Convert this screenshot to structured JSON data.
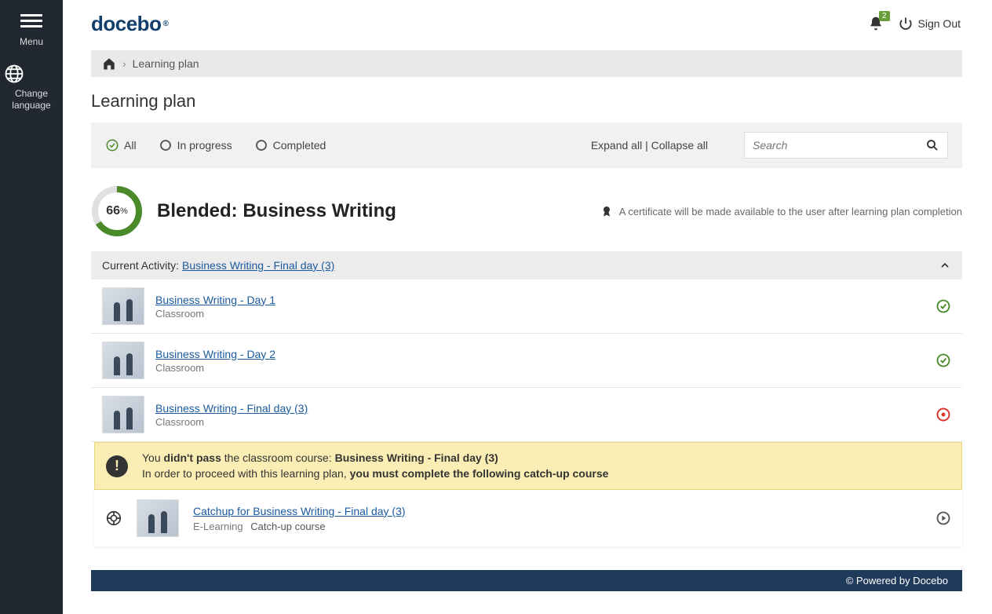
{
  "sidebar": {
    "menu_label": "Menu",
    "change_language_label": "Change\nlanguage"
  },
  "header": {
    "logo_text": "docebo",
    "notification_count": "2",
    "signout_label": "Sign Out"
  },
  "breadcrumb": {
    "sep": "›",
    "current": "Learning plan"
  },
  "page": {
    "title": "Learning plan"
  },
  "filters": {
    "all": "All",
    "in_progress": "In progress",
    "completed": "Completed",
    "expand_all": "Expand all",
    "separator": " | ",
    "collapse_all": "Collapse all",
    "search_placeholder": "Search"
  },
  "plan": {
    "progress_percent": "66",
    "percent_symbol": "%",
    "title": "Blended: Business Writing",
    "certificate_note": "A certificate will be made available to the user after learning plan completion"
  },
  "activity": {
    "label": "Current Activity:",
    "link": "Business Writing - Final day (3)"
  },
  "courses": [
    {
      "title": "Business Writing - Day 1",
      "type": "Classroom",
      "status": "complete"
    },
    {
      "title": "Business Writing - Day 2",
      "type": "Classroom",
      "status": "complete"
    },
    {
      "title": "Business Writing - Final day (3)",
      "type": "Classroom",
      "status": "failed"
    }
  ],
  "warning": {
    "line1_a": "You ",
    "line1_b": "didn't pass",
    "line1_c": " the classroom course: ",
    "line1_d": "Business Writing - Final day (3)",
    "line2_a": "In order to proceed with this learning plan, ",
    "line2_b": "you must complete the following catch-up course"
  },
  "catchup": {
    "title": "Catchup for Business Writing - Final day (3)",
    "type": "E-Learning",
    "tag": "Catch-up course"
  },
  "footer": {
    "text": "© Powered by Docebo"
  },
  "colors": {
    "accent_green": "#4a8a2a",
    "link_blue": "#1a5a9e",
    "fail_red": "#d9372c"
  }
}
